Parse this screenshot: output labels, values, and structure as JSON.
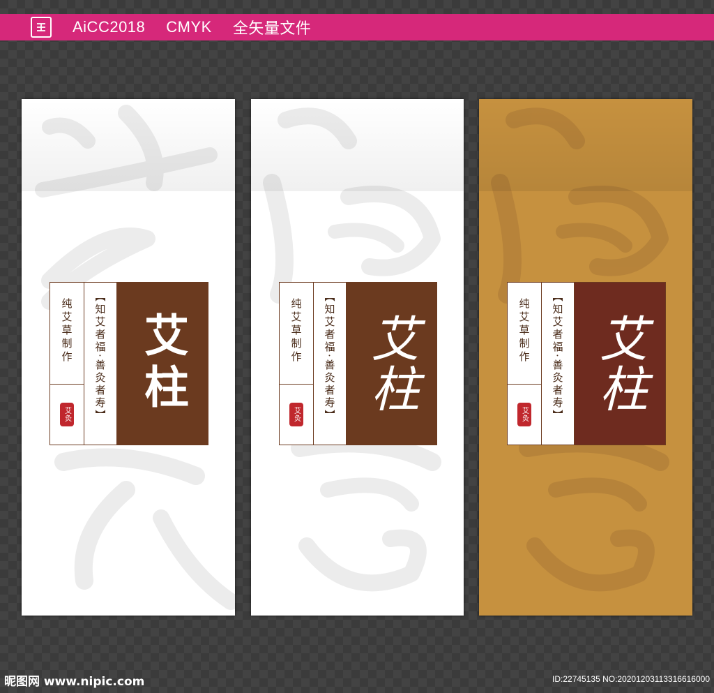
{
  "header": {
    "software": "AiCC2018",
    "color_mode": "CMYK",
    "file_note": "全矢量文件",
    "logo_icon": "nipic-logo-icon"
  },
  "colors": {
    "header_bar": "#d6287a",
    "label_brown": "#6b3a1f",
    "label_maroon": "#6e2b1f",
    "panel_gold": "#c6913f",
    "panel_white": "#ffffff"
  },
  "panels": [
    {
      "background": "#ffffff",
      "label": {
        "side_text": "纯艾草制作",
        "motto": "【知艾者福·善灸者寿】",
        "seal_text": "艾灸",
        "brand": "艾柱"
      }
    },
    {
      "background": "#ffffff",
      "label": {
        "side_text": "纯艾草制作",
        "motto": "【知艾者福·善灸者寿】",
        "seal_text": "艾灸",
        "brand": "艾柱"
      }
    },
    {
      "background": "#c6913f",
      "label": {
        "side_text": "纯艾草制作",
        "motto": "【知艾者福·善灸者寿】",
        "seal_text": "艾灸",
        "brand": "艾柱"
      }
    }
  ],
  "footer": {
    "watermark": "昵图网 www.nipic.com",
    "image_id": "ID:22745135 NO:20201203113316616000"
  }
}
